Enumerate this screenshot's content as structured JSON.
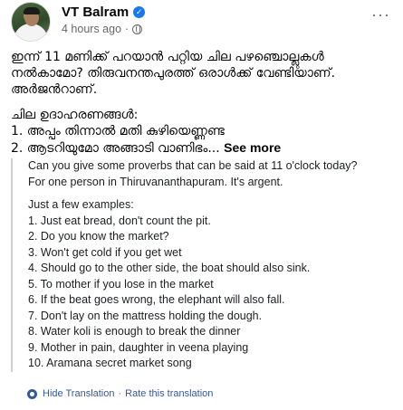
{
  "post": {
    "author": "VT Balram",
    "time": "4 hours ago",
    "time_separator": "·",
    "more_icon": "···",
    "original_lines_1": [
      "ഇന്ന് 11 മണിക്ക് പറയാൻ പറ്റിയ ചില പഴഞ്ചൊല്ലുകൾ",
      "നൽകാമോ? തിരുവനന്തപുരത്ത് ഒരാൾക്ക് വേണ്ടിയാണ്.",
      "അർജൻറാണ്."
    ],
    "original_lines_2": [
      "ചില ഉദാഹരണങ്ങൾ:",
      "1. അപ്പം തിന്നാൽ മതി കുഴിയെണ്ണണ്ട"
    ],
    "original_last_line": "2. ആടറിയുമോ അങ്ങാടി വാണിഭം...",
    "see_more": "See more"
  },
  "translation": {
    "intro": [
      "Can you give some proverbs that can be said at 11 o'clock today?",
      "For one person in Thiruvananthapuram. It's argent."
    ],
    "examples_heading": "Just a few examples:",
    "examples": [
      "1. Just eat bread, don't count the pit.",
      "2. Do you know the market?",
      "3. Won't get cold if you get wet",
      "4. Should go to the other side, the boat should also sink.",
      "5. To mother if you lose in the market",
      "6. If the beat goes wrong, the elephant will also fall.",
      "7. Don't lay on the mattress holding the dough.",
      "8. Water koli is enough to break the dinner",
      "9. Mother in pain, daughter in veena playing",
      "10. Aramana secret market song"
    ],
    "hide_label": "Hide Translation",
    "link_separator": "·",
    "rate_label": "Rate this translation"
  }
}
